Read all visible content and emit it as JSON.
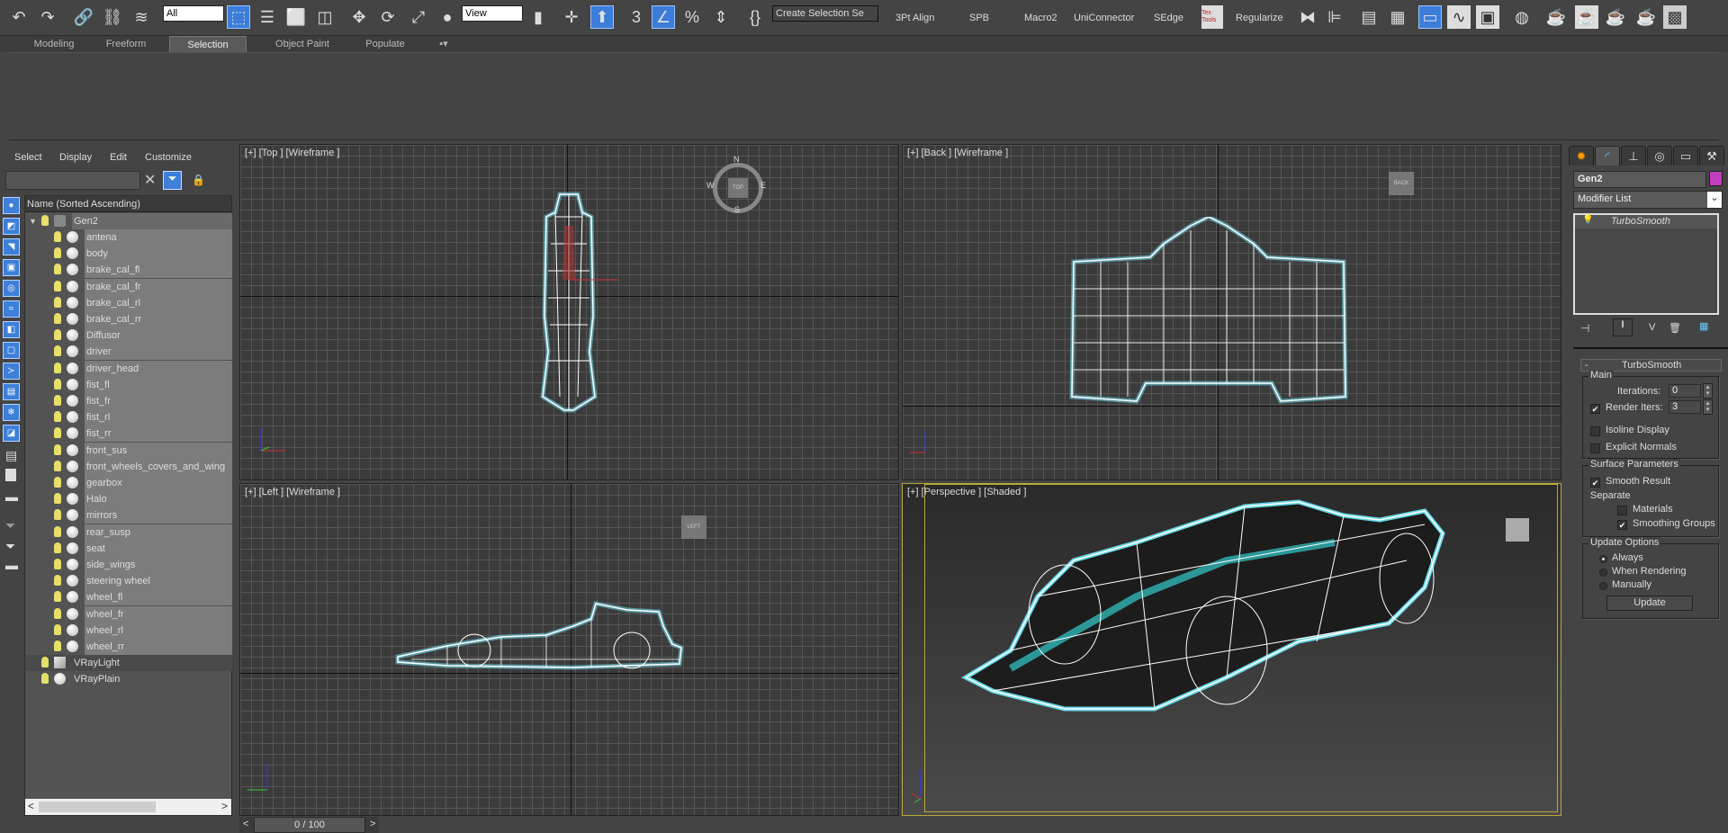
{
  "toolbar": {
    "selection_filter": "All",
    "ref_coord": "View",
    "selection_set_placeholder": "Create Selection Se",
    "snap_angle": "3",
    "scripts": [
      "3Pt Align",
      "SPB",
      "Macro2",
      "UniConnector",
      "SEdge"
    ],
    "textools": "Tex Tools",
    "regularize": "Regularize"
  },
  "ribbon_tabs": [
    "Modeling",
    "Freeform",
    "Selection",
    "Object Paint",
    "Populate"
  ],
  "explorer": {
    "menu": [
      "Select",
      "Display",
      "Edit",
      "Customize"
    ],
    "search_value": "",
    "column_header": "Name (Sorted Ascending)",
    "root": "Gen2",
    "children": [
      "antena",
      "body",
      "brake_cal_fl",
      "brake_cal_fr",
      "brake_cal_rl",
      "brake_cal_rr",
      "Diffusor",
      "driver",
      "driver_head",
      "fist_fl",
      "fist_fr",
      "fist_rl",
      "fist_rr",
      "front_sus",
      "front_wheels_covers_and_wing",
      "gearbox",
      "Halo",
      "mirrors",
      "rear_susp",
      "seat",
      "side_wings",
      "steering wheel",
      "wheel_fl",
      "wheel_fr",
      "wheel_rl",
      "wheel_rr"
    ],
    "others": [
      "VRayLight",
      "VRayPlain"
    ]
  },
  "viewports": {
    "top": "[+] [Top ] [Wireframe ]",
    "back": "[+] [Back ] [Wireframe ]",
    "left": "[+] [Left ] [Wireframe ]",
    "persp": "[+] [Perspective ] [Shaded ]",
    "cube_top": "TOP",
    "cube_back": "BACK",
    "cube_left": "LEFT",
    "compass": {
      "n": "N",
      "s": "S",
      "e": "E",
      "w": "W"
    }
  },
  "timeline": {
    "value": "0 / 100",
    "prev": "<",
    "next": ">"
  },
  "command_panel": {
    "object_name": "Gen2",
    "object_color": "#c13ec1",
    "modifier_list": "Modifier List",
    "stack": [
      "TurboSmooth"
    ],
    "rollout_title": "TurboSmooth",
    "rollout_toggle": "-",
    "main_group": "Main",
    "iterations_label": "Iterations:",
    "iterations": "0",
    "render_iters_label": "Render Iters:",
    "render_iters": "3",
    "render_iters_checked": true,
    "isoline": "Isoline Display",
    "explicit_normals": "Explicit Normals",
    "surface_group": "Surface Parameters",
    "smooth_result": "Smooth Result",
    "separate": "Separate",
    "materials": "Materials",
    "smoothing_groups": "Smoothing Groups",
    "update_group": "Update Options",
    "update_options": [
      "Always",
      "When Rendering",
      "Manually"
    ],
    "update_selected": "Always",
    "update_button": "Update"
  }
}
